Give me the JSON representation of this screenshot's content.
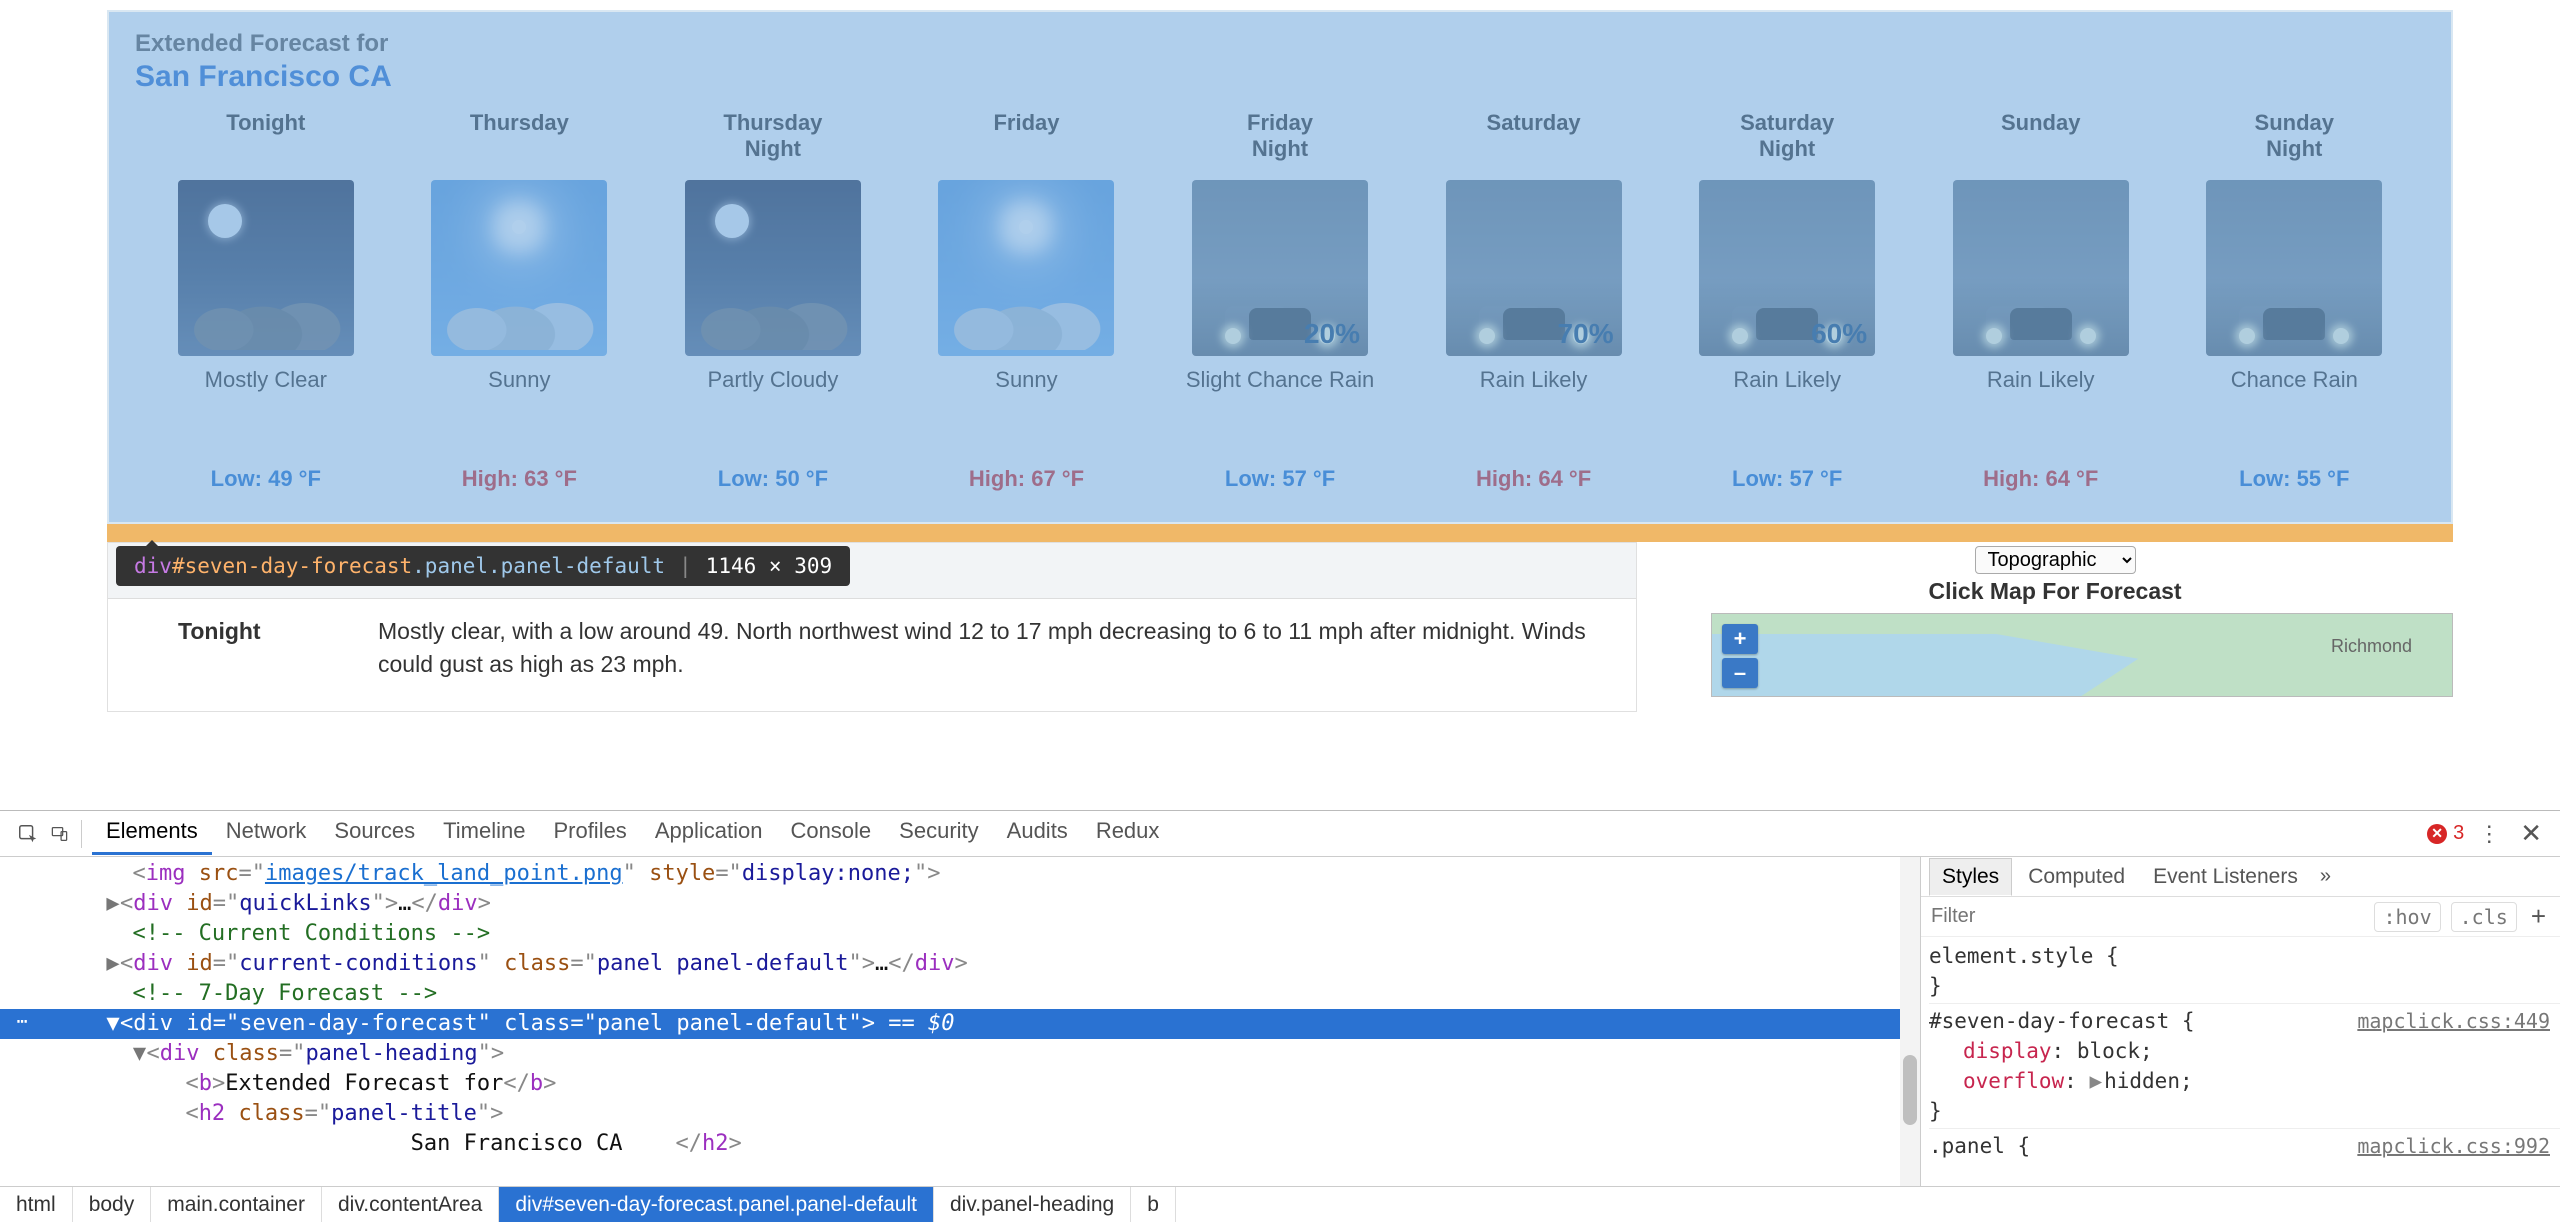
{
  "page": {
    "heading_prefix": "Extended Forecast for",
    "location": "San Francisco CA"
  },
  "divider_color": "#f0b868",
  "forecast": [
    {
      "label1": "Tonight",
      "label2": "",
      "icon": "night-clear",
      "pct": "",
      "cond": "Mostly Clear",
      "temp_type": "low",
      "temp": "Low: 49 °F"
    },
    {
      "label1": "Thursday",
      "label2": "",
      "icon": "sunny",
      "pct": "",
      "cond": "Sunny",
      "temp_type": "high",
      "temp": "High: 63 °F"
    },
    {
      "label1": "Thursday",
      "label2": "Night",
      "icon": "night-partly",
      "pct": "",
      "cond": "Partly Cloudy",
      "temp_type": "low",
      "temp": "Low: 50 °F"
    },
    {
      "label1": "Friday",
      "label2": "",
      "icon": "sunny",
      "pct": "",
      "cond": "Sunny",
      "temp_type": "high",
      "temp": "High: 67 °F"
    },
    {
      "label1": "Friday",
      "label2": "Night",
      "icon": "fog",
      "pct": "20%",
      "cond": "Slight Chance Rain",
      "temp_type": "low",
      "temp": "Low: 57 °F"
    },
    {
      "label1": "Saturday",
      "label2": "",
      "icon": "fog",
      "pct": "70%",
      "cond": "Rain Likely",
      "temp_type": "high",
      "temp": "High: 64 °F"
    },
    {
      "label1": "Saturday",
      "label2": "Night",
      "icon": "fog",
      "pct": "60%",
      "cond": "Rain Likely",
      "temp_type": "low",
      "temp": "Low: 57 °F"
    },
    {
      "label1": "Sunday",
      "label2": "",
      "icon": "fog",
      "pct": "",
      "cond": "Rain Likely",
      "temp_type": "high",
      "temp": "High: 64 °F"
    },
    {
      "label1": "Sunday",
      "label2": "Night",
      "icon": "fog",
      "pct": "",
      "cond": "Chance Rain",
      "temp_type": "low",
      "temp": "Low: 55 °F"
    }
  ],
  "element_tooltip": {
    "selector_tag": "div",
    "selector_id": "#seven-day-forecast",
    "selector_cls": ".panel.panel-default",
    "dims": "1146 × 309"
  },
  "detail": {
    "label": "Tonight",
    "text": "Mostly clear, with a low around 49. North northwest wind 12 to 17 mph decreasing to 6 to 11 mph after midnight. Winds could gust as high as 23 mph."
  },
  "map": {
    "select_value": "Topographic",
    "title": "Click Map For Forecast",
    "zoom_in": "+",
    "zoom_out": "–",
    "city": "Richmond"
  },
  "devtools": {
    "tabs": [
      "Elements",
      "Network",
      "Sources",
      "Timeline",
      "Profiles",
      "Application",
      "Console",
      "Security",
      "Audits",
      "Redux"
    ],
    "active_tab": "Elements",
    "error_count": "3",
    "side_tabs": [
      "Styles",
      "Computed",
      "Event Listeners"
    ],
    "active_side": "Styles",
    "filter_placeholder": "Filter",
    "hov": ":hov",
    "cls": ".cls",
    "styles": {
      "element_style": "element.style {",
      "rule_sel": "#seven-day-forecast {",
      "rule_src": "mapclick.css:449",
      "rule_display_prop": "display",
      "rule_display_val": "block;",
      "rule_overflow_prop": "overflow",
      "rule_overflow_val": "hidden;",
      "next_sel": ".panel {",
      "next_src": "mapclick.css:992"
    },
    "dom": {
      "l1_a": "<",
      "l1_tag": "img",
      "l1_b": " ",
      "l1_attr1": "src",
      "l1_eq": "=\"",
      "l1_link": "images/track_land_point.png",
      "l1_c": "\" ",
      "l1_attr2": "style",
      "l1_c2": "=\"",
      "l1_v2": "display:none;",
      "l1_end": "\">",
      "l2_a": "<",
      "l2_tag": "div",
      "l2_b": " ",
      "l2_attr": "id",
      "l2_c": "=\"",
      "l2_v": "quickLinks",
      "l2_d": "\">",
      "l2_dots": "…",
      "l2_close": "</div>",
      "l3": "<!-- Current Conditions -->",
      "l4_a": "<",
      "l4_tag": "div",
      "l4_b": " ",
      "l4_attr": "id",
      "l4_c": "=\"",
      "l4_v": "current-conditions",
      "l4_d": "\" ",
      "l4_attr2": "class",
      "l4_e": "=\"",
      "l4_v2": "panel panel-default",
      "l4_f": "\">",
      "l4_dots": "…",
      "l4_close": "</div>",
      "l5": "<!-- 7-Day Forecast -->",
      "sel_a": "<",
      "sel_tag": "div",
      "sel_b": " ",
      "sel_attr": "id",
      "sel_c": "=\"",
      "sel_v": "seven-day-forecast",
      "sel_d": "\" ",
      "sel_attr2": "class",
      "sel_e": "=\"",
      "sel_v2": "panel panel-default",
      "sel_f": "\"> ",
      "sel_eq0": "== $0",
      "l7_a": "<",
      "l7_tag": "div",
      "l7_b": " ",
      "l7_attr": "class",
      "l7_c": "=\"",
      "l7_v": "panel-heading",
      "l7_d": "\">",
      "l8_a": "<",
      "l8_tag": "b",
      "l8_b": ">",
      "l8_txt": "Extended Forecast for",
      "l8_close": "</b>",
      "l9_a": "<",
      "l9_tag": "h2",
      "l9_b": " ",
      "l9_attr": "class",
      "l9_c": "=\"",
      "l9_v": "panel-title",
      "l9_d": "\">",
      "l10_txt": "San Francisco CA    ",
      "l10_close": "</h2>"
    },
    "crumbs": [
      "html",
      "body",
      "main.container",
      "div.contentArea",
      "div#seven-day-forecast.panel.panel-default",
      "div.panel-heading",
      "b"
    ],
    "active_crumb": 4
  }
}
